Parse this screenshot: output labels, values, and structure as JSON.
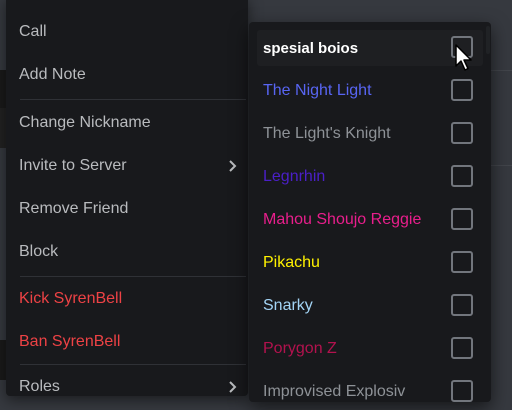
{
  "menu": {
    "items": [
      {
        "label": "Call"
      },
      {
        "label": "Add Note"
      },
      {
        "label": "Change Nickname"
      },
      {
        "label": "Invite to Server"
      },
      {
        "label": "Remove Friend"
      },
      {
        "label": "Block"
      },
      {
        "label": "Kick SyrenBell"
      },
      {
        "label": "Ban SyrenBell"
      },
      {
        "label": "Roles"
      }
    ]
  },
  "roles": {
    "items": [
      {
        "label": "spesial boios",
        "color": "#ffffff"
      },
      {
        "label": "The Night Light",
        "color": "#5865f2"
      },
      {
        "label": "The Light's Knight",
        "color": "#8e9297"
      },
      {
        "label": "Legnrhin",
        "color": "#4b1fc9"
      },
      {
        "label": "Mahou Shoujo Reggie",
        "color": "#e91e8c"
      },
      {
        "label": "Pikachu",
        "color": "#fff200"
      },
      {
        "label": "Snarky",
        "color": "#a3d4f5"
      },
      {
        "label": "Porygon Z",
        "color": "#b3124e"
      },
      {
        "label": "Improvised Explosiv",
        "color": "#8e9297"
      }
    ]
  },
  "colors": {
    "menu_bg": "#18191c",
    "text": "#b9bbbe",
    "danger": "#ed4245",
    "checkbox_border": "#72767d"
  }
}
